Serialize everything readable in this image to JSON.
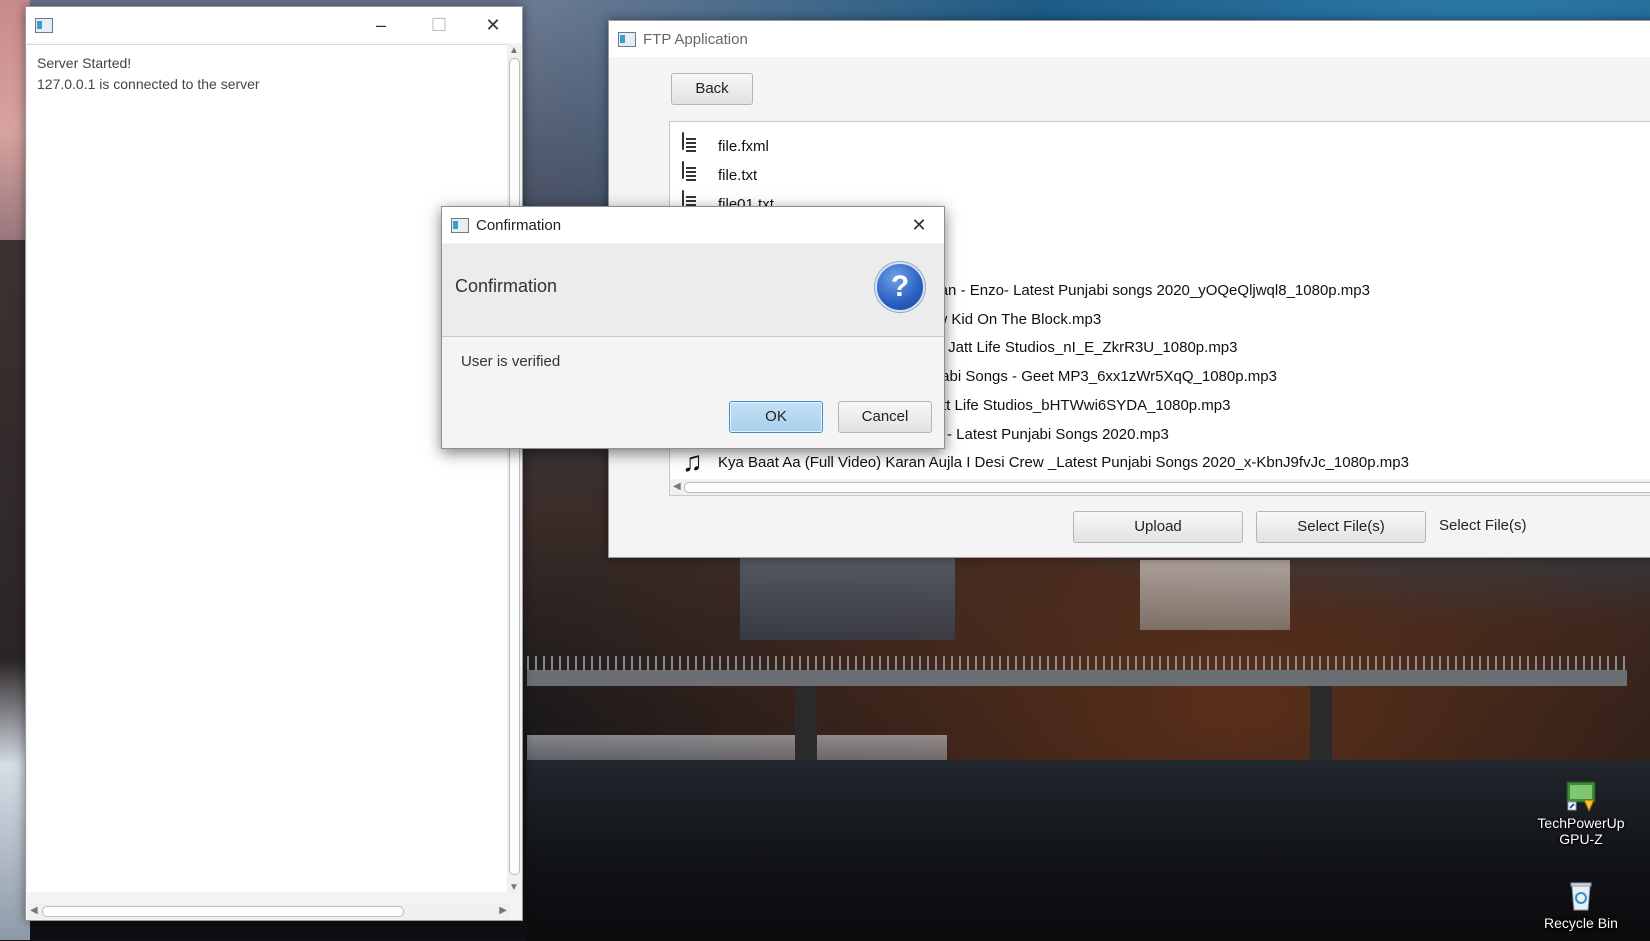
{
  "server_window": {
    "title": "",
    "log_lines": [
      "Server Started!",
      "127.0.0.1 is connected to the server"
    ]
  },
  "ftp_window": {
    "title": "FTP Application",
    "back_label": "Back",
    "files": [
      {
        "name": "file.fxml",
        "icon": "document-icon"
      },
      {
        "name": "file.txt",
        "icon": "text-file-icon"
      },
      {
        "name": "file01.txt",
        "icon": "text-file-icon"
      },
      {
        "name": "ra Goyal - Parmish Verma- Nirmaan - Enzo- Latest Punjabi songs 2020_yOQeQljwql8_1080p.mp3",
        "icon": "music-note-icon"
      },
      {
        "name": "eo) Jay Trak - Director Whiz - New Kid On The Block.mp3",
        "icon": "music-note-icon"
      },
      {
        "name": "ideo) Latest Punjabi Songs 2019 - Jatt Life Studios_nI_E_ZkrR3U_1080p.mp3",
        "icon": "music-note-icon"
      },
      {
        "name": "l Video) Satti Dhillon - Latest Punjabi Songs - Geet MP3_6xx1zWr5XqQ_1080p.mp3",
        "icon": "music-note-icon"
      },
      {
        "name": "g) Teji - Latest Punjabi Songs - Jatt Life Studios_bHTWwi6SYDA_1080p.mp3",
        "icon": "music-note-icon"
      },
      {
        "name": "al Video) - Desi Crew - Rupan Bal - Latest Punjabi Songs 2020.mp3",
        "icon": "music-note-icon"
      },
      {
        "name": "Kya Baat Aa (Full Video) Karan Aujla I Desi Crew _Latest Punjabi Songs 2020_x-KbnJ9fvJc_1080p.mp3",
        "icon": "music-note-icon"
      }
    ],
    "upload_label": "Upload",
    "select_files_label": "Select File(s)",
    "selected_files_text": "Select File(s)"
  },
  "dialog": {
    "title": "Confirmation",
    "header": "Confirmation",
    "content": "User is verified",
    "ok_label": "OK",
    "cancel_label": "Cancel"
  },
  "desktop_icons": [
    {
      "label": "TechPowerUp GPU-Z"
    },
    {
      "label": "Recycle Bin"
    }
  ],
  "colors": {
    "accent_blue": "#3d9bd0",
    "default_button": "#a8cfec",
    "question_icon": "#2a5fbf"
  }
}
